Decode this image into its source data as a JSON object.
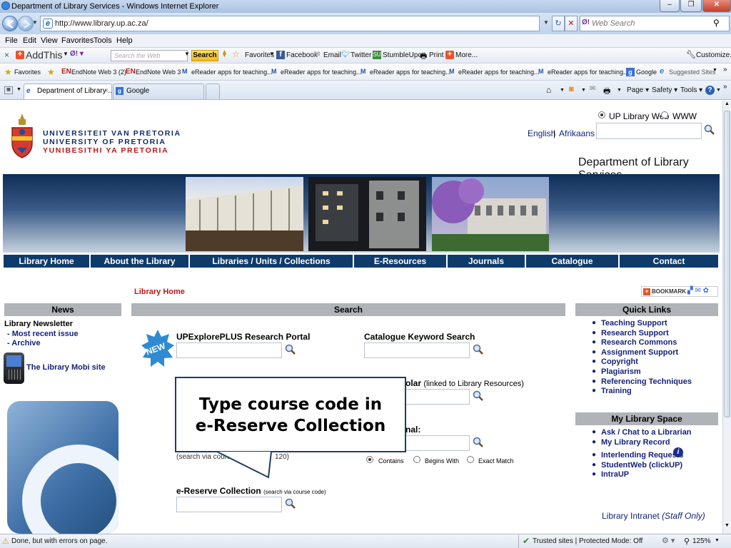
{
  "window": {
    "title": "Department of Library Services - Windows Internet Explorer",
    "url": "http://www.library.up.ac.za/",
    "web_search_placeholder": "Web Search"
  },
  "menu": [
    "File",
    "Edit",
    "View",
    "Favorites",
    "Tools",
    "Help"
  ],
  "addthis": {
    "label": "AddThis",
    "search_placeholder": "Search the Web",
    "search_button": "Search",
    "items": [
      "Favorites",
      "Facebook",
      "Email",
      "Twitter",
      "StumbleUpon",
      "Print",
      "More..."
    ],
    "customize": "Customize..."
  },
  "favorites_bar": {
    "label": "Favorites",
    "items": [
      "EndNote Web 3 (2)",
      "EndNote Web 3",
      "eReader apps for teaching...",
      "eReader apps for teaching...",
      "eReader apps for teaching...",
      "eReader apps for teaching...",
      "eReader apps for teaching...",
      "Google",
      "Suggested Sites"
    ]
  },
  "tabs": [
    "Department of Library ...",
    "Google"
  ],
  "command_bar": [
    "Page",
    "Safety",
    "Tools"
  ],
  "status": {
    "left": "Done, but with errors on page.",
    "zone": "Trusted sites | Protected Mode: Off",
    "zoom": "125%"
  },
  "site": {
    "logo_lines": [
      "UNIVERSITEIT VAN PRETORIA",
      "UNIVERSITY OF PRETORIA",
      "YUNIBESITHI YA PRETORIA"
    ],
    "radio_options": [
      "UP Library Web",
      "WWW"
    ],
    "lang_english": "English",
    "lang_sep": "|",
    "lang_afrikaans": "Afrikaans",
    "department": "Department of Library Services",
    "nav": [
      "Library Home",
      "About the Library",
      "Libraries / Units / Collections",
      "E-Resources",
      "Journals",
      "Catalogue",
      "Contact"
    ],
    "breadcrumb": "Library Home",
    "bookmark": "BOOKMARK",
    "news": {
      "header": "News",
      "newsletter": "Library Newsletter",
      "items": [
        "- Most recent issue",
        "- Archive"
      ],
      "mobi": "The Library Mobi site"
    },
    "search": {
      "header": "Search",
      "new_badge": "NEW",
      "upexplore": "UPExplorePLUS Research Portal",
      "catalogue_kw": "Catalogue Keyword Search",
      "scholar_bold": "olar",
      "scholar_rest": "(linked to Library Resources)",
      "journal_partial": "nal:",
      "course_note": "(search via cours",
      "course_note_end": "120)",
      "radio": [
        "Contains",
        "Begins With",
        "Exact Match"
      ],
      "ereserve": "e-Reserve Collection",
      "ereserve_note": "(search via course code)"
    },
    "callout": {
      "line1": "Type course code in",
      "line2": "e-Reserve Collection"
    },
    "quicklinks": {
      "header": "Quick Links",
      "items": [
        "Teaching Support",
        "Research Support",
        "Research Commons",
        "Assignment Support",
        "Copyright",
        "Plagiarism",
        "Referencing Techniques",
        "Training"
      ]
    },
    "mylibrary": {
      "header": "My Library Space",
      "items": [
        "Ask / Chat to a Librarian",
        "My Library Record",
        "Interlending Requests",
        "StudentWeb (clickUP)",
        "IntraUP"
      ]
    },
    "intranet": "Library Intranet",
    "intranet_note": "(Staff Only)"
  },
  "colors": {
    "nav_blue": "#0f3b6b",
    "link_blue": "#15237a",
    "header_grey": "#b0b3b8",
    "breadcrumb_red": "#c0151b"
  }
}
